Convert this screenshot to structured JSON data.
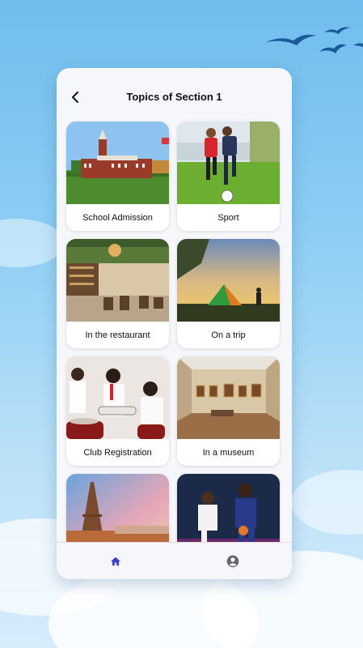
{
  "header": {
    "title": "Topics of Section 1",
    "back_icon": "chevron-left-icon"
  },
  "topics": [
    {
      "label": "School Admission"
    },
    {
      "label": "Sport"
    },
    {
      "label": "In the restaurant"
    },
    {
      "label": "On a trip"
    },
    {
      "label": "Club Registration"
    },
    {
      "label": "In a museum"
    },
    {
      "label": ""
    },
    {
      "label": ""
    }
  ],
  "bottom_nav": {
    "items": [
      {
        "icon": "home-icon",
        "active": true
      },
      {
        "icon": "profile-icon",
        "active": false
      }
    ]
  },
  "colors": {
    "accent": "#3a3fd0",
    "inactive": "#666666",
    "sky": "#8ccdf3"
  }
}
